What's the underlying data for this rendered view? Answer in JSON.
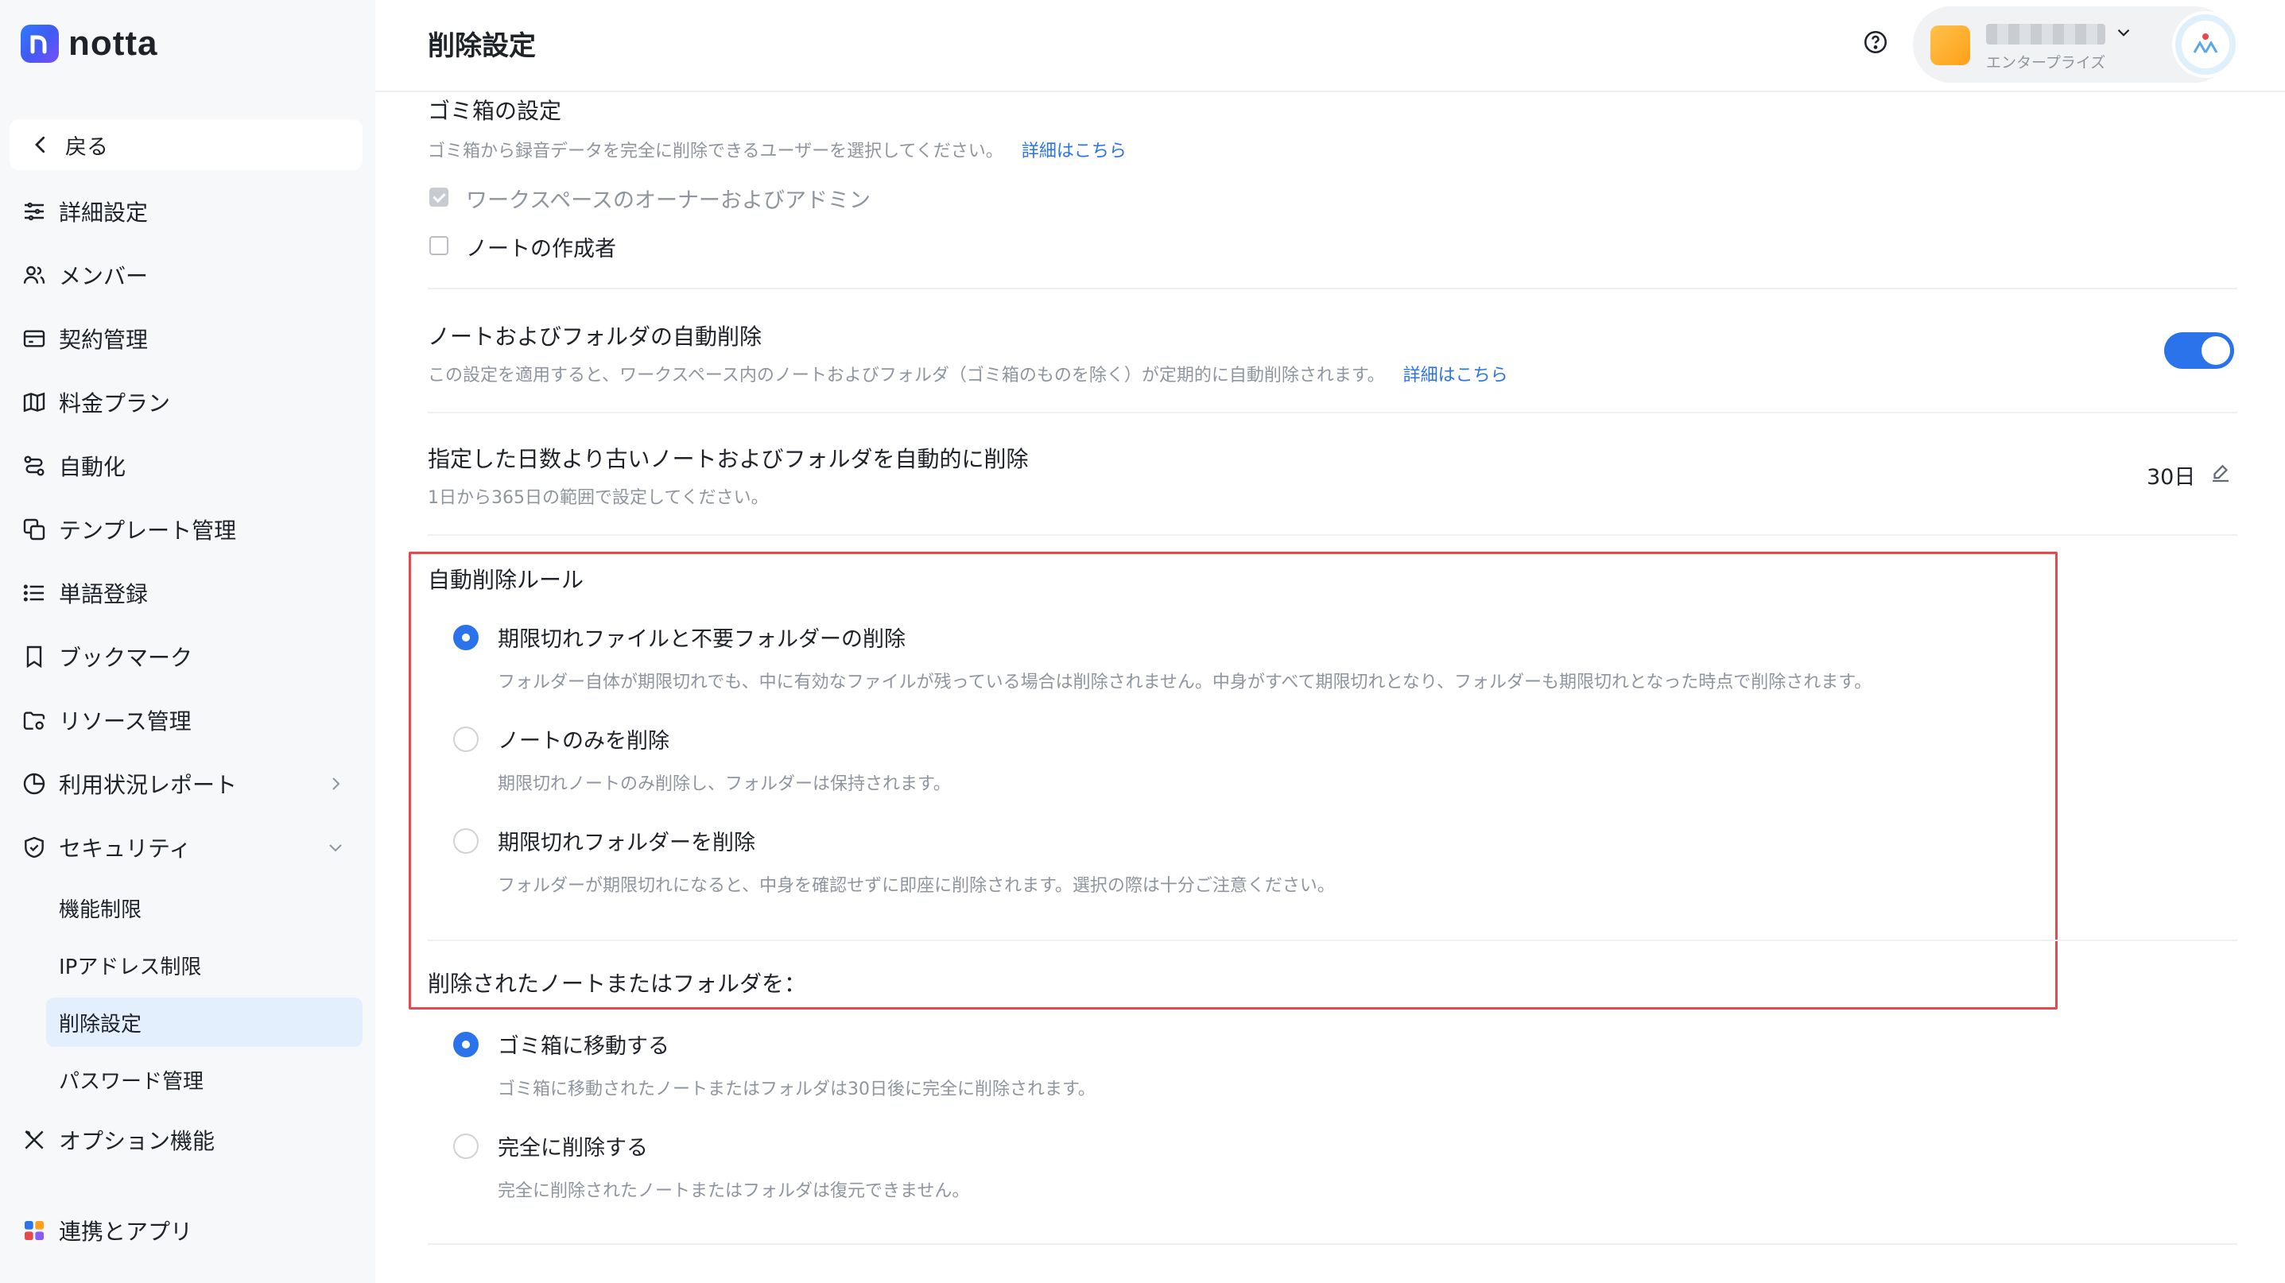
{
  "app": {
    "logo_text": "notta"
  },
  "sidebar": {
    "back_label": "戻る",
    "items": [
      {
        "label": "詳細設定",
        "icon": "sliders-icon"
      },
      {
        "label": "メンバー",
        "icon": "members-icon"
      },
      {
        "label": "契約管理",
        "icon": "contract-icon"
      },
      {
        "label": "料金プラン",
        "icon": "map-icon"
      },
      {
        "label": "自動化",
        "icon": "automation-icon"
      },
      {
        "label": "テンプレート管理",
        "icon": "template-icon"
      },
      {
        "label": "単語登録",
        "icon": "list-icon"
      },
      {
        "label": "ブックマーク",
        "icon": "bookmark-icon"
      },
      {
        "label": "リソース管理",
        "icon": "resource-icon"
      },
      {
        "label": "利用状況レポート",
        "icon": "pie-chart-icon"
      },
      {
        "label": "セキュリティ",
        "icon": "shield-icon"
      }
    ],
    "security_sub": [
      "機能制限",
      "IPアドレス制限",
      "削除設定",
      "パスワード管理"
    ],
    "options_label": "オプション機能",
    "integrations_label": "連携とアプリ"
  },
  "header": {
    "title": "削除設定",
    "account_role": "エンタープライズ"
  },
  "trash": {
    "title": "ゴミ箱の設定",
    "desc": "ゴミ箱から録音データを完全に削除できるユーザーを選択してください。",
    "link": "詳細はこちら",
    "option_owner": "ワークスペースのオーナーおよびアドミン",
    "option_creator": "ノートの作成者"
  },
  "auto_delete": {
    "title": "ノートおよびフォルダの自動削除",
    "desc": "この設定を適用すると、ワークスペース内のノートおよびフォルダ（ゴミ箱のものを除く）が定期的に自動削除されます。",
    "link": "詳細はこちら",
    "enabled": true
  },
  "days": {
    "title": "指定した日数より古いノートおよびフォルダを自動的に削除",
    "desc": "1日から365日の範囲で設定してください。",
    "value": "30日"
  },
  "rules": {
    "title": "自動削除ルール",
    "options": [
      {
        "label": "期限切れファイルと不要フォルダーの削除",
        "desc": "フォルダー自体が期限切れでも、中に有効なファイルが残っている場合は削除されません。中身がすべて期限切れとなり、フォルダーも期限切れとなった時点で削除されます。",
        "selected": true
      },
      {
        "label": "ノートのみを削除",
        "desc": "期限切れノートのみ削除し、フォルダーは保持されます。",
        "selected": false
      },
      {
        "label": "期限切れフォルダーを削除",
        "desc": "フォルダーが期限切れになると、中身を確認せずに即座に削除されます。選択の際は十分ご注意ください。",
        "selected": false
      }
    ]
  },
  "deleted_items": {
    "title": "削除されたノートまたはフォルダを：",
    "options": [
      {
        "label": "ゴミ箱に移動する",
        "desc": "ゴミ箱に移動されたノートまたはフォルダは30日後に完全に削除されます。",
        "selected": true
      },
      {
        "label": "完全に削除する",
        "desc": "完全に削除されたノートまたはフォルダは復元できません。",
        "selected": false
      }
    ]
  },
  "colors": {
    "accent": "#2a73ea",
    "highlight": "#e5484d",
    "sidebar_bg": "#f7f8fa",
    "active_bg": "#e3effd"
  }
}
